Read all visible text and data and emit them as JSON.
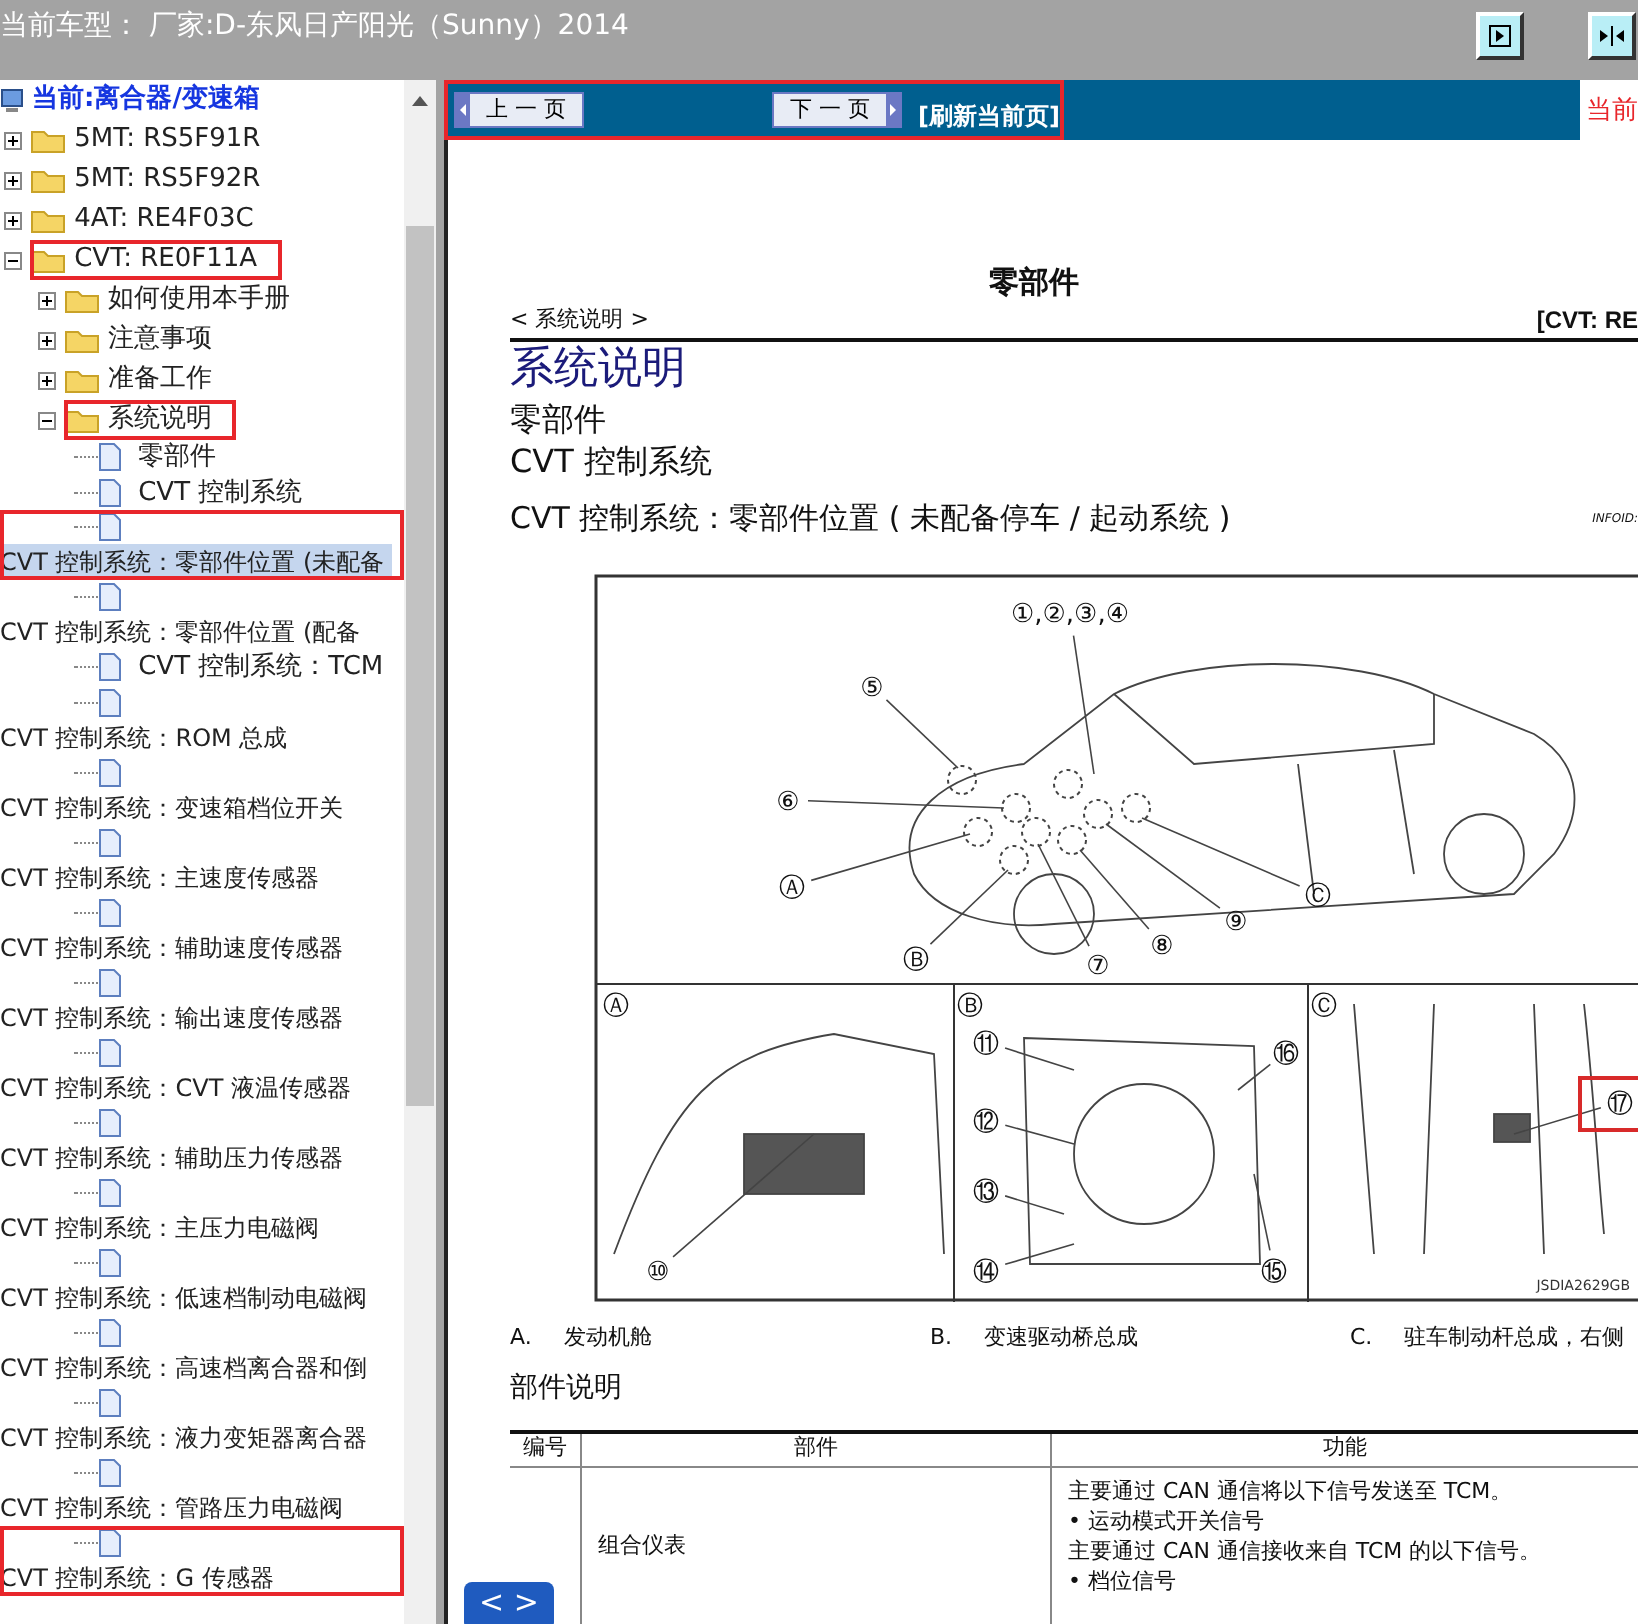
{
  "header": {
    "title": "当前车型： 厂家:D-东风日产阳光（Sunny）2014"
  },
  "tree": {
    "root": "当前:离合器/变速箱",
    "items": [
      {
        "label": "5MT: RS5F91R",
        "kind": "folder",
        "expanded": false,
        "selected": false,
        "annotated": false
      },
      {
        "label": "5MT: RS5F92R",
        "kind": "folder",
        "expanded": false,
        "selected": false,
        "annotated": false
      },
      {
        "label": "4AT: RE4F03C",
        "kind": "folder",
        "expanded": false,
        "selected": false,
        "annotated": false
      },
      {
        "label": "CVT: RE0F11A",
        "kind": "folder",
        "expanded": true,
        "selected": false,
        "annotated": true,
        "children": [
          {
            "label": "如何使用本手册",
            "kind": "folder",
            "expanded": false,
            "selected": false,
            "annotated": false
          },
          {
            "label": "注意事项",
            "kind": "folder",
            "expanded": false,
            "selected": false,
            "annotated": false
          },
          {
            "label": "准备工作",
            "kind": "folder",
            "expanded": false,
            "selected": false,
            "annotated": false
          },
          {
            "label": "系统说明",
            "kind": "folder",
            "expanded": true,
            "selected": false,
            "annotated": true,
            "children": [
              {
                "label": "零部件",
                "kind": "leaf",
                "selected": false,
                "annotated": false
              },
              {
                "label": "CVT 控制系统",
                "kind": "leaf",
                "selected": false,
                "annotated": false
              },
              {
                "label": "CVT 控制系统：零部件位置 (未配备",
                "kind": "leaf_wrapped",
                "selected": true,
                "annotated": true
              },
              {
                "label": "CVT 控制系统：零部件位置 (配备",
                "kind": "leaf_wrapped",
                "selected": false,
                "annotated": false
              },
              {
                "label": "CVT 控制系统：TCM",
                "kind": "leaf",
                "selected": false,
                "annotated": false
              },
              {
                "label": "CVT 控制系统：ROM 总成",
                "kind": "leaf_wrapped",
                "selected": false,
                "annotated": false
              },
              {
                "label": "CVT 控制系统：变速箱档位开关",
                "kind": "leaf_wrapped",
                "selected": false,
                "annotated": false
              },
              {
                "label": "CVT 控制系统：主速度传感器",
                "kind": "leaf_wrapped",
                "selected": false,
                "annotated": false
              },
              {
                "label": "CVT 控制系统：辅助速度传感器",
                "kind": "leaf_wrapped",
                "selected": false,
                "annotated": false
              },
              {
                "label": "CVT 控制系统：输出速度传感器",
                "kind": "leaf_wrapped",
                "selected": false,
                "annotated": false
              },
              {
                "label": "CVT 控制系统：CVT 液温传感器",
                "kind": "leaf_wrapped",
                "selected": false,
                "annotated": false
              },
              {
                "label": "CVT 控制系统：辅助压力传感器",
                "kind": "leaf_wrapped",
                "selected": false,
                "annotated": false
              },
              {
                "label": "CVT 控制系统：主压力电磁阀",
                "kind": "leaf_wrapped",
                "selected": false,
                "annotated": false
              },
              {
                "label": "CVT 控制系统：低速档制动电磁阀",
                "kind": "leaf_wrapped",
                "selected": false,
                "annotated": false
              },
              {
                "label": "CVT 控制系统：高速档离合器和倒",
                "kind": "leaf_wrapped",
                "selected": false,
                "annotated": false
              },
              {
                "label": "CVT 控制系统：液力变矩器离合器",
                "kind": "leaf_wrapped",
                "selected": false,
                "annotated": false
              },
              {
                "label": "CVT 控制系统：管路压力电磁阀",
                "kind": "leaf_wrapped",
                "selected": false,
                "annotated": false
              },
              {
                "label": "CVT 控制系统：G 传感器",
                "kind": "leaf_wrapped",
                "selected": false,
                "annotated": true
              }
            ]
          }
        ]
      }
    ]
  },
  "toolbar": {
    "prev": "上 一 页",
    "next": "下 一 页",
    "refresh": "[刷新当前页]",
    "current": "当前",
    "annotated": true
  },
  "document": {
    "page_title": "零部件",
    "breadcrumb": "< 系统说明 >",
    "model_tag": "[CVT: RE",
    "section": "系统说明",
    "subheads": [
      "零部件",
      "CVT 控制系统"
    ],
    "topic": "CVT 控制系统：零部件位置 ( 未配备停车 / 起动系统 )",
    "infoid": "INFOID:",
    "figure": {
      "callouts": [
        {
          "label": "①,②,③,④",
          "annotated": false
        },
        {
          "label": "⑤",
          "annotated": false
        },
        {
          "label": "⑥",
          "annotated": false
        },
        {
          "label": "Ⓐ",
          "annotated": false
        },
        {
          "label": "Ⓑ",
          "annotated": false
        },
        {
          "label": "⑦",
          "annotated": false
        },
        {
          "label": "⑧",
          "annotated": false
        },
        {
          "label": "⑨",
          "annotated": false
        },
        {
          "label": "Ⓒ",
          "annotated": false
        },
        {
          "label": "Ⓐ",
          "annotated": false
        },
        {
          "label": "Ⓑ",
          "annotated": false
        },
        {
          "label": "Ⓒ",
          "annotated": false
        },
        {
          "label": "⑩",
          "annotated": false
        },
        {
          "label": "⑪",
          "annotated": false
        },
        {
          "label": "⑫",
          "annotated": false
        },
        {
          "label": "⑬",
          "annotated": false
        },
        {
          "label": "⑭",
          "annotated": false
        },
        {
          "label": "⑮",
          "annotated": false
        },
        {
          "label": "⑯",
          "annotated": false
        },
        {
          "label": "⑰",
          "annotated": true
        }
      ],
      "code": "JSDIA2629GB"
    },
    "captions": [
      {
        "letter": "A.",
        "text": "发动机舱"
      },
      {
        "letter": "B.",
        "text": "变速驱动桥总成"
      },
      {
        "letter": "C.",
        "text": "驻车制动杆总成，右侧"
      }
    ],
    "table_title": "部件说明",
    "table": {
      "columns": [
        "编号",
        "部件",
        "功能"
      ],
      "rows": [
        {
          "part": "组合仪表",
          "function": [
            "主要通过 CAN 通信将以下信号发送至 TCM。",
            "• 运动模式开关信号",
            "主要通过 CAN 通信接收来自 TCM 的以下信号。",
            "• 档位信号"
          ]
        }
      ]
    }
  },
  "float_button": "< >"
}
